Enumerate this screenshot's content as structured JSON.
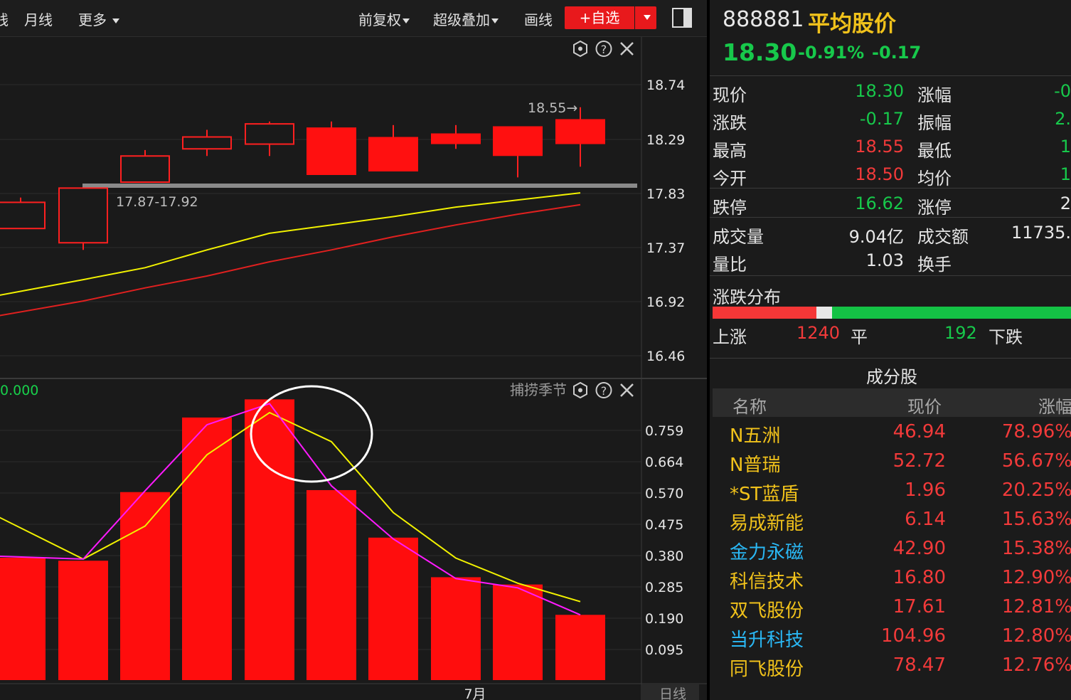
{
  "toolbar": {
    "partial_left": "线",
    "monthly": "月线",
    "more": "更多",
    "adjust": "前复权",
    "overlay": "超级叠加",
    "draw": "画线",
    "add_favorite": "+自选"
  },
  "main_chart": {
    "price_axis": [
      "18.74",
      "18.29",
      "17.83",
      "17.37",
      "16.92",
      "16.46"
    ],
    "high_note": "18.55→",
    "gap_note": "17.87-17.92"
  },
  "sub_chart": {
    "indicator_value": "0.000",
    "indicator_name": "捕捞季节",
    "value_axis": [
      "0.759",
      "0.664",
      "0.570",
      "0.475",
      "0.380",
      "0.285",
      "0.190",
      "0.095"
    ],
    "month_label": "7月",
    "period_label": "日线"
  },
  "chart_data": {
    "type": "bar",
    "candles": [
      {
        "open": 17.53,
        "close": 17.75,
        "high": 17.79,
        "low": 17.53
      },
      {
        "open": 17.41,
        "close": 17.87,
        "high": 17.87,
        "low": 17.35
      },
      {
        "open": 17.92,
        "close": 18.14,
        "high": 18.19,
        "low": 17.92
      },
      {
        "open": 18.2,
        "close": 18.3,
        "high": 18.36,
        "low": 18.14
      },
      {
        "open": 18.24,
        "close": 18.41,
        "high": 18.43,
        "low": 18.14
      },
      {
        "open": 18.38,
        "close": 17.98,
        "high": 18.43,
        "low": 17.98
      },
      {
        "open": 18.3,
        "close": 18.01,
        "high": 18.4,
        "low": 18.01
      },
      {
        "open": 18.33,
        "close": 18.24,
        "high": 18.4,
        "low": 18.2
      },
      {
        "open": 18.39,
        "close": 18.14,
        "high": 18.39,
        "low": 17.96
      },
      {
        "open": 18.45,
        "close": 18.24,
        "high": 18.55,
        "low": 18.05
      }
    ],
    "ma_yellow": [
      16.96,
      17.1,
      17.2,
      17.35,
      17.49,
      17.56,
      17.63,
      17.71,
      17.77,
      17.83
    ],
    "ma_red": [
      16.79,
      16.92,
      17.03,
      17.13,
      17.25,
      17.35,
      17.46,
      17.56,
      17.65,
      17.73
    ],
    "volume_bars": [
      0.373,
      0.364,
      0.572,
      0.798,
      0.853,
      0.578,
      0.434,
      0.314,
      0.292,
      0.2
    ],
    "line_magenta": [
      0.378,
      0.369,
      0.576,
      0.776,
      0.84,
      0.591,
      0.43,
      0.31,
      0.282,
      0.2
    ],
    "line_yellow": [
      0.503,
      0.369,
      0.469,
      0.685,
      0.813,
      0.725,
      0.51,
      0.372,
      0.296,
      0.24
    ]
  },
  "quote": {
    "code": "888881",
    "name": "平均股价",
    "price": "18.30",
    "pct": "-0.91%",
    "change": "-0.17",
    "rows": [
      {
        "l1": "现价",
        "v1": "18.30",
        "l2": "涨幅",
        "v2": "-0"
      },
      {
        "l1": "涨跌",
        "v1": "-0.17",
        "l2": "振幅",
        "v2": "2."
      },
      {
        "l1": "最高",
        "v1": "18.55",
        "l2": "最低",
        "v2": "1"
      },
      {
        "l1": "今开",
        "v1": "18.50",
        "l2": "均价",
        "v2": "1"
      },
      {
        "l1": "跌停",
        "v1": "16.62",
        "l2": "涨停",
        "v2": "2"
      },
      {
        "l1": "成交量",
        "v1": "9.04亿",
        "l2": "成交额",
        "v2": "11735."
      },
      {
        "l1": "量比",
        "v1": "1.03",
        "l2": "换手",
        "v2": ""
      }
    ]
  },
  "distribution": {
    "title": "涨跌分布",
    "up_label": "上涨",
    "up_count": "1240",
    "flat_label": "平",
    "flat_count": "192",
    "down_label": "下跌"
  },
  "components": {
    "title": "成分股",
    "headers": [
      "名称",
      "现价",
      "涨幅"
    ],
    "rows": [
      {
        "name": "N五洲",
        "price": "46.94",
        "pct": "78.96%"
      },
      {
        "name": "N普瑞",
        "price": "52.72",
        "pct": "56.67%"
      },
      {
        "name": "*ST蓝盾",
        "price": "1.96",
        "pct": "20.25%"
      },
      {
        "name": "易成新能",
        "price": "6.14",
        "pct": "15.63%"
      },
      {
        "name": "金力永磁",
        "price": "42.90",
        "pct": "15.38%"
      },
      {
        "name": "科信技术",
        "price": "16.80",
        "pct": "12.90%"
      },
      {
        "name": "双飞股份",
        "price": "17.61",
        "pct": "12.81%"
      },
      {
        "name": "当升科技",
        "price": "104.96",
        "pct": "12.80%"
      },
      {
        "name": "同飞股份",
        "price": "78.47",
        "pct": "12.76%"
      }
    ]
  }
}
